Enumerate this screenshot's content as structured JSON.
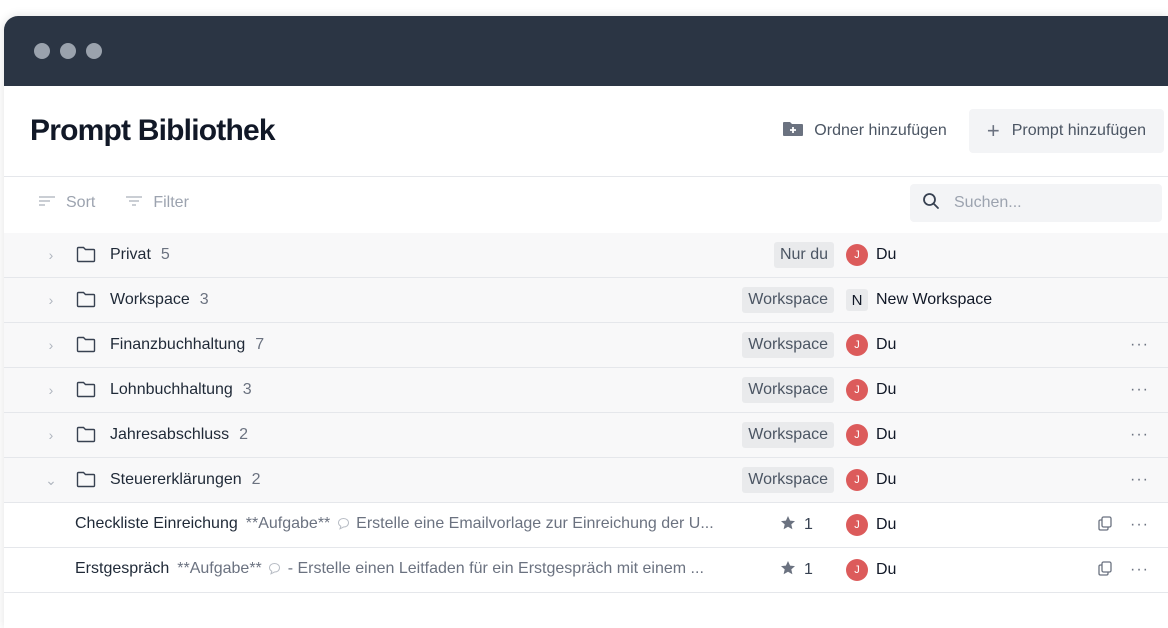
{
  "page_title": "Prompt Bibliothek",
  "header": {
    "add_folder_label": "Ordner hinzufügen",
    "add_prompt_label": "Prompt hinzufügen"
  },
  "toolbar": {
    "sort_label": "Sort",
    "filter_label": "Filter",
    "search_placeholder": "Suchen..."
  },
  "folders": [
    {
      "name": "Privat",
      "count": "5",
      "visibility": "Nur du",
      "owner_initial": "J",
      "owner": "Du",
      "expanded": false
    },
    {
      "name": "Workspace",
      "count": "3",
      "visibility": "Workspace",
      "owner_initial": "N",
      "owner": "New Workspace",
      "expanded": false
    },
    {
      "name": "Finanzbuchhaltung",
      "count": "7",
      "visibility": "Workspace",
      "owner_initial": "J",
      "owner": "Du",
      "expanded": false
    },
    {
      "name": "Lohnbuchhaltung",
      "count": "3",
      "visibility": "Workspace",
      "owner_initial": "J",
      "owner": "Du",
      "expanded": false
    },
    {
      "name": "Jahresabschluss",
      "count": "2",
      "visibility": "Workspace",
      "owner_initial": "J",
      "owner": "Du",
      "expanded": false
    },
    {
      "name": "Steuererklärungen",
      "count": "2",
      "visibility": "Workspace",
      "owner_initial": "J",
      "owner": "Du",
      "expanded": true
    }
  ],
  "prompts": [
    {
      "name": "Checkliste Einreichung",
      "desc_a": "**Aufgabe**",
      "desc_b": "Erstelle eine Emailvorlage zur Einreichung der U...",
      "stars": "1",
      "owner_initial": "J",
      "owner": "Du"
    },
    {
      "name": "Erstgespräch",
      "desc_a": "**Aufgabe**",
      "desc_b": "- Erstelle einen Leitfaden für ein Erstgespräch mit einem ...",
      "stars": "1",
      "owner_initial": "J",
      "owner": "Du"
    }
  ],
  "colors": {
    "titlebar": "#2b3544",
    "avatar": "#dc5b5b",
    "tag_bg": "#e9eaec"
  }
}
